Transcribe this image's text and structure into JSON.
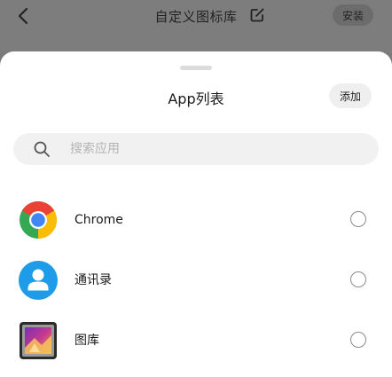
{
  "header": {
    "title": "自定义图标库",
    "install_label": "安装"
  },
  "sheet": {
    "title": "App列表",
    "add_label": "添加",
    "search": {
      "placeholder": "搜索应用",
      "value": ""
    },
    "apps": [
      {
        "name": "Chrome",
        "icon": "chrome-icon",
        "selected": false
      },
      {
        "name": "通讯录",
        "icon": "contacts-icon",
        "selected": false
      },
      {
        "name": "图库",
        "icon": "gallery-icon",
        "selected": false
      }
    ]
  },
  "colors": {
    "overlay": "#7a7a7a",
    "sheet_bg": "#ffffff",
    "search_bg": "#f1f1f1",
    "contacts_blue": "#1e9be9"
  }
}
